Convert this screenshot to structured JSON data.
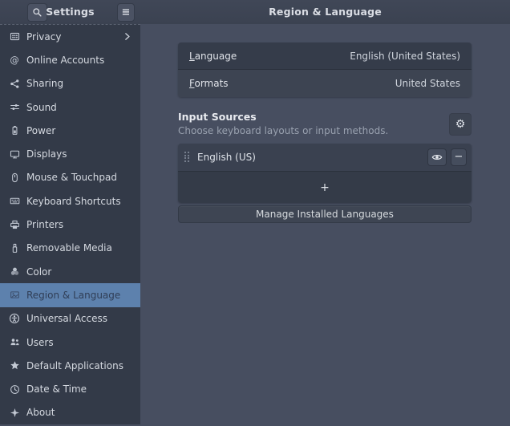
{
  "header": {
    "app_title": "Settings",
    "page_title": "Region & Language"
  },
  "sidebar": {
    "items": [
      {
        "label": "Privacy",
        "icon": "privacy-icon",
        "chevron": true
      },
      {
        "label": "Online Accounts",
        "icon": "online-accounts-icon"
      },
      {
        "label": "Sharing",
        "icon": "sharing-icon"
      },
      {
        "label": "Sound",
        "icon": "sound-icon"
      },
      {
        "label": "Power",
        "icon": "power-icon"
      },
      {
        "label": "Displays",
        "icon": "displays-icon"
      },
      {
        "label": "Mouse & Touchpad",
        "icon": "mouse-icon"
      },
      {
        "label": "Keyboard Shortcuts",
        "icon": "keyboard-icon"
      },
      {
        "label": "Printers",
        "icon": "printer-icon"
      },
      {
        "label": "Removable Media",
        "icon": "removable-media-icon"
      },
      {
        "label": "Color",
        "icon": "color-icon"
      },
      {
        "label": "Region & Language",
        "icon": "region-language-icon",
        "selected": true
      },
      {
        "label": "Universal Access",
        "icon": "universal-access-icon"
      },
      {
        "label": "Users",
        "icon": "users-icon"
      },
      {
        "label": "Default Applications",
        "icon": "default-apps-icon"
      },
      {
        "label": "Date & Time",
        "icon": "date-time-icon"
      },
      {
        "label": "About",
        "icon": "about-icon"
      }
    ]
  },
  "main": {
    "region_rows": [
      {
        "label": "Language",
        "value": "English (United States)"
      },
      {
        "label": "Formats",
        "value": "United States"
      }
    ],
    "input_sources": {
      "title": "Input Sources",
      "subtitle": "Choose keyboard layouts or input methods.",
      "rows": [
        {
          "label": "English (US)"
        }
      ],
      "add_button": "+",
      "manage_button": "Manage Installed Languages"
    }
  },
  "colors": {
    "headerbar_bg": "#3d4454",
    "sidebar_bg": "#333a48",
    "main_bg": "#474e60",
    "selected_bg": "#5d81ad",
    "card_row_dark": "#353c4a",
    "card_row_light": "#3d4452"
  }
}
